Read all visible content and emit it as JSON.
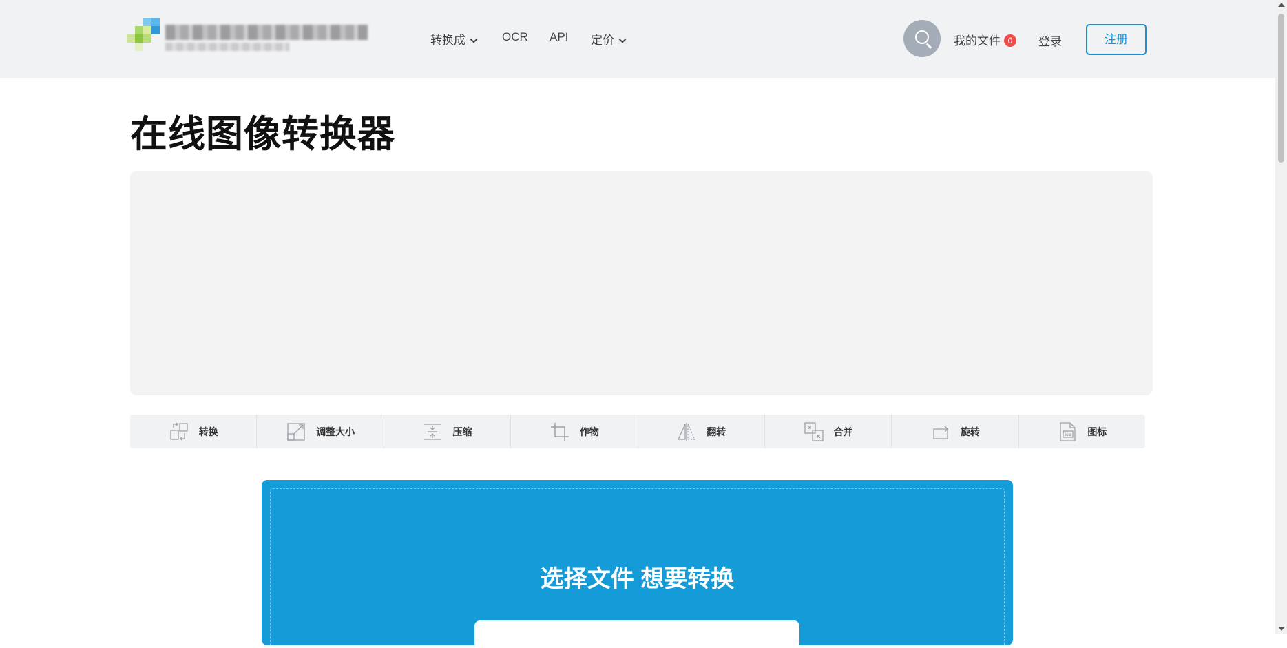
{
  "header": {
    "nav": [
      {
        "label": "转换成",
        "has_dropdown": true
      },
      {
        "label": "OCR",
        "has_dropdown": false
      },
      {
        "label": "API",
        "has_dropdown": false
      },
      {
        "label": "定价",
        "has_dropdown": true
      }
    ],
    "search_icon": "search-icon",
    "my_files_label": "我的文件",
    "my_files_count": "0",
    "login_label": "登录",
    "signup_label": "注册"
  },
  "main": {
    "title": "在线图像转换器",
    "tools": [
      {
        "label": "转换",
        "icon": "convert-icon"
      },
      {
        "label": "调整大小",
        "icon": "resize-icon"
      },
      {
        "label": "压缩",
        "icon": "compress-icon"
      },
      {
        "label": "作物",
        "icon": "crop-icon"
      },
      {
        "label": "翻转",
        "icon": "flip-icon"
      },
      {
        "label": "合并",
        "icon": "merge-icon"
      },
      {
        "label": "旋转",
        "icon": "rotate-icon"
      },
      {
        "label": "图标",
        "icon": "ico-icon"
      }
    ],
    "upload_title": "选择文件 想要转换"
  },
  "colors": {
    "accent": "#159cd8",
    "signup_border": "#1d8fcf",
    "badge": "#f24b4b",
    "header_bg": "#f1f2f4"
  }
}
